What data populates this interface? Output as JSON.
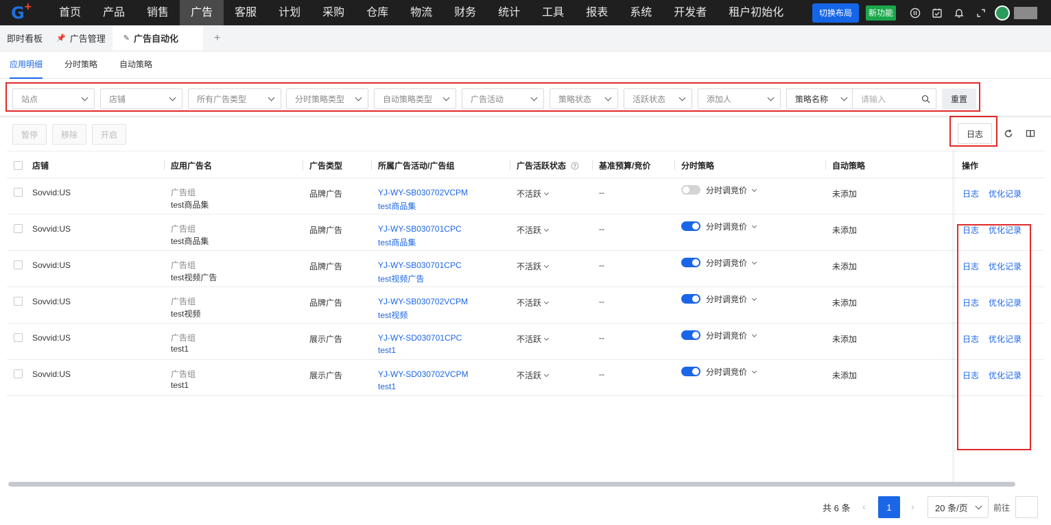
{
  "nav": {
    "items": [
      "首页",
      "产品",
      "销售",
      "广告",
      "客服",
      "计划",
      "采购",
      "仓库",
      "物流",
      "财务",
      "统计",
      "工具",
      "报表",
      "系统",
      "开发者",
      "租户初始化"
    ],
    "active_index": 3,
    "switch_layout": "切换布局",
    "new_feature": "新功能"
  },
  "tabs": {
    "dashboard": "即时看板",
    "ad_manage": "广告管理",
    "ad_auto": "广告自动化",
    "add": "+"
  },
  "subtabs": [
    "应用明细",
    "分时策略",
    "自动策略"
  ],
  "filters": {
    "site": "站点",
    "shop": "店铺",
    "ad_type": "所有广告类型",
    "time_strategy_type": "分时策略类型",
    "auto_strategy_type": "自动策略类型",
    "campaign": "广告活动",
    "strategy_status": "策略状态",
    "active_status": "活跃状态",
    "creator": "添加人",
    "strategy_name": "策略名称",
    "input_placeholder": "请输入",
    "reset": "重置"
  },
  "actions": {
    "pause": "暂停",
    "remove": "移除",
    "enable": "开启",
    "log": "日志"
  },
  "table": {
    "headers": {
      "shop": "店铺",
      "ad_name": "应用广告名",
      "ad_type": "广告类型",
      "campaign": "所属广告活动/广告组",
      "active": "广告活跃状态",
      "budget": "基准预算/竞价",
      "time_strategy": "分时策略",
      "auto_strategy": "自动策略",
      "ops": "操作"
    },
    "rows": [
      {
        "shop": "Sovvid:US",
        "name_label": "广告组",
        "name": "test商品集",
        "type": "品牌广告",
        "campaign": "YJ-WY-SB030702VCPM",
        "group": "test商品集",
        "active": "不活跃",
        "budget": "--",
        "toggle_on": false,
        "strategy": "分时调竞价",
        "auto": "未添加",
        "op_log": "日志",
        "op_record": "优化记录"
      },
      {
        "shop": "Sovvid:US",
        "name_label": "广告组",
        "name": "test商品集",
        "type": "品牌广告",
        "campaign": "YJ-WY-SB030701CPC",
        "group": "test商品集",
        "active": "不活跃",
        "budget": "--",
        "toggle_on": true,
        "strategy": "分时调竞价",
        "auto": "未添加",
        "op_log": "日志",
        "op_record": "优化记录"
      },
      {
        "shop": "Sovvid:US",
        "name_label": "广告组",
        "name": "test视频广告",
        "type": "品牌广告",
        "campaign": "YJ-WY-SB030701CPC",
        "group": "test视频广告",
        "active": "不活跃",
        "budget": "--",
        "toggle_on": true,
        "strategy": "分时调竞价",
        "auto": "未添加",
        "op_log": "日志",
        "op_record": "优化记录"
      },
      {
        "shop": "Sovvid:US",
        "name_label": "广告组",
        "name": "test视频",
        "type": "品牌广告",
        "campaign": "YJ-WY-SB030702VCPM",
        "group": "test视频",
        "active": "不活跃",
        "budget": "--",
        "toggle_on": true,
        "strategy": "分时调竞价",
        "auto": "未添加",
        "op_log": "日志",
        "op_record": "优化记录"
      },
      {
        "shop": "Sovvid:US",
        "name_label": "广告组",
        "name": "test1",
        "type": "展示广告",
        "campaign": "YJ-WY-SD030701CPC",
        "group": "test1",
        "active": "不活跃",
        "budget": "--",
        "toggle_on": true,
        "strategy": "分时调竞价",
        "auto": "未添加",
        "op_log": "日志",
        "op_record": "优化记录"
      },
      {
        "shop": "Sovvid:US",
        "name_label": "广告组",
        "name": "test1",
        "type": "展示广告",
        "campaign": "YJ-WY-SD030702VCPM",
        "group": "test1",
        "active": "不活跃",
        "budget": "--",
        "toggle_on": true,
        "strategy": "分时调竞价",
        "auto": "未添加",
        "op_log": "日志",
        "op_record": "优化记录"
      }
    ]
  },
  "pagination": {
    "total": "共 6 条",
    "current": "1",
    "page_size": "20 条/页",
    "goto": "前往"
  },
  "colors": {
    "accent": "#1b66e6",
    "highlight_border": "#e02828",
    "nav_bg": "#1f1f1f"
  }
}
